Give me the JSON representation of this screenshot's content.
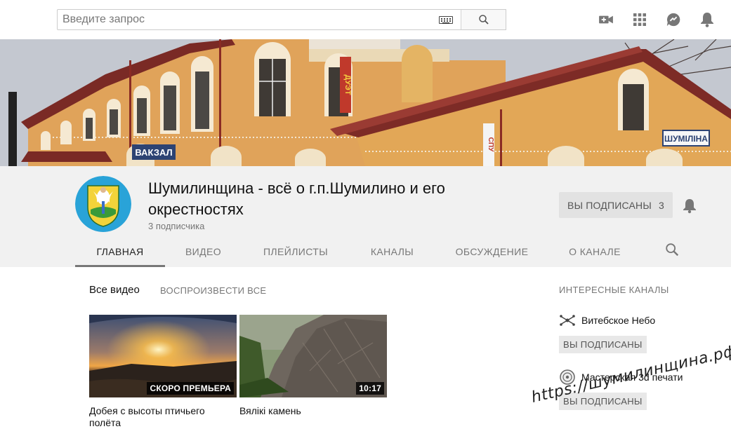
{
  "search": {
    "placeholder": "Введите запрос"
  },
  "channel": {
    "title": "Шумилинщина - всё о г.п.Шумилино и его окрестностях",
    "subscribers": "3 подписчика",
    "subscribed_label": "ВЫ ПОДПИСАНЫ",
    "subscribed_count": "3"
  },
  "banner": {
    "sign_left": "ВАКЗАЛ",
    "sign_right": "ШУМІЛІНА",
    "sign_vertical": "ДУЭТ",
    "sign_vertical2": "СПУ"
  },
  "tabs": [
    {
      "label": "ГЛАВНАЯ",
      "active": true
    },
    {
      "label": "ВИДЕО"
    },
    {
      "label": "ПЛЕЙЛИСТЫ"
    },
    {
      "label": "КАНАЛЫ"
    },
    {
      "label": "ОБСУЖДЕНИЕ"
    },
    {
      "label": "О КАНАЛЕ"
    }
  ],
  "section": {
    "title": "Все видео",
    "play_all": "ВОСПРОИЗВЕСТИ ВСЕ"
  },
  "videos": [
    {
      "title": "Добея с высоты птичьего полёта",
      "badge": "СКОРО ПРЕМЬЕРА"
    },
    {
      "title": "Вялікі камень",
      "badge": "10:17"
    }
  ],
  "sidebar": {
    "title": "ИНТЕРЕСНЫЕ КАНАЛЫ",
    "channels": [
      {
        "name": "Витебское Небо",
        "button": "ВЫ ПОДПИСАНЫ"
      },
      {
        "name": "Мастерская 3d печати",
        "button": "ВЫ ПОДПИСАНЫ"
      }
    ]
  },
  "watermark": "https://шумилинщина.рф",
  "colors": {
    "header_bg": "#f1f1f1",
    "accent_tab": "#777777",
    "badge_bg": "#000000"
  },
  "icons": [
    "keyboard-icon",
    "search-icon",
    "video-camera-icon",
    "apps-grid-icon",
    "messages-icon",
    "bell-icon"
  ]
}
